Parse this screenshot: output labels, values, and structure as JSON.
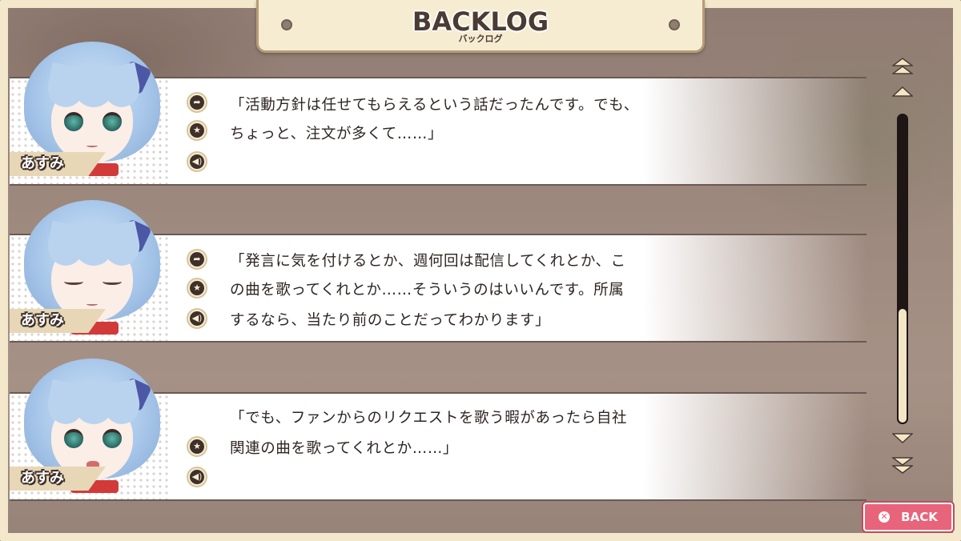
{
  "header": {
    "title": "BACKLOG",
    "subtitle": "バックログ"
  },
  "entries": [
    {
      "speaker": "あすみ",
      "expression": "worried",
      "buttons": [
        "jump-icon",
        "favorite-star-icon",
        "voice-replay-icon"
      ],
      "lines": [
        "「活動方針は任せてもらえるという話だったんです。でも、",
        "ちょっと、注文が多くて……」"
      ]
    },
    {
      "speaker": "あすみ",
      "expression": "eyes-closed",
      "buttons": [
        "jump-icon",
        "favorite-star-icon",
        "voice-replay-icon"
      ],
      "lines": [
        "「発言に気を付けるとか、週何回は配信してくれとか、こ",
        "の曲を歌ってくれとか……そういうのはいいんです。所属",
        "するなら、当たり前のことだってわかります」"
      ]
    },
    {
      "speaker": "あすみ",
      "expression": "troubled",
      "buttons": [
        "favorite-star-icon",
        "voice-replay-icon"
      ],
      "lines": [
        "「でも、ファンからのリクエストを歌う暇があったら自社",
        "関連の曲を歌ってくれとか……」"
      ]
    }
  ],
  "scrollbar": {
    "top_arrows": [
      "scroll-to-top-icon",
      "scroll-up-icon"
    ],
    "bottom_arrows": [
      "scroll-down-icon",
      "scroll-to-bottom-icon"
    ],
    "position": 1.0
  },
  "back_button": {
    "label": "BACK",
    "icon": "close-icon"
  },
  "colors": {
    "frame": "#f3e8cc",
    "accent": "#e8647a",
    "text": "#2e2522"
  }
}
